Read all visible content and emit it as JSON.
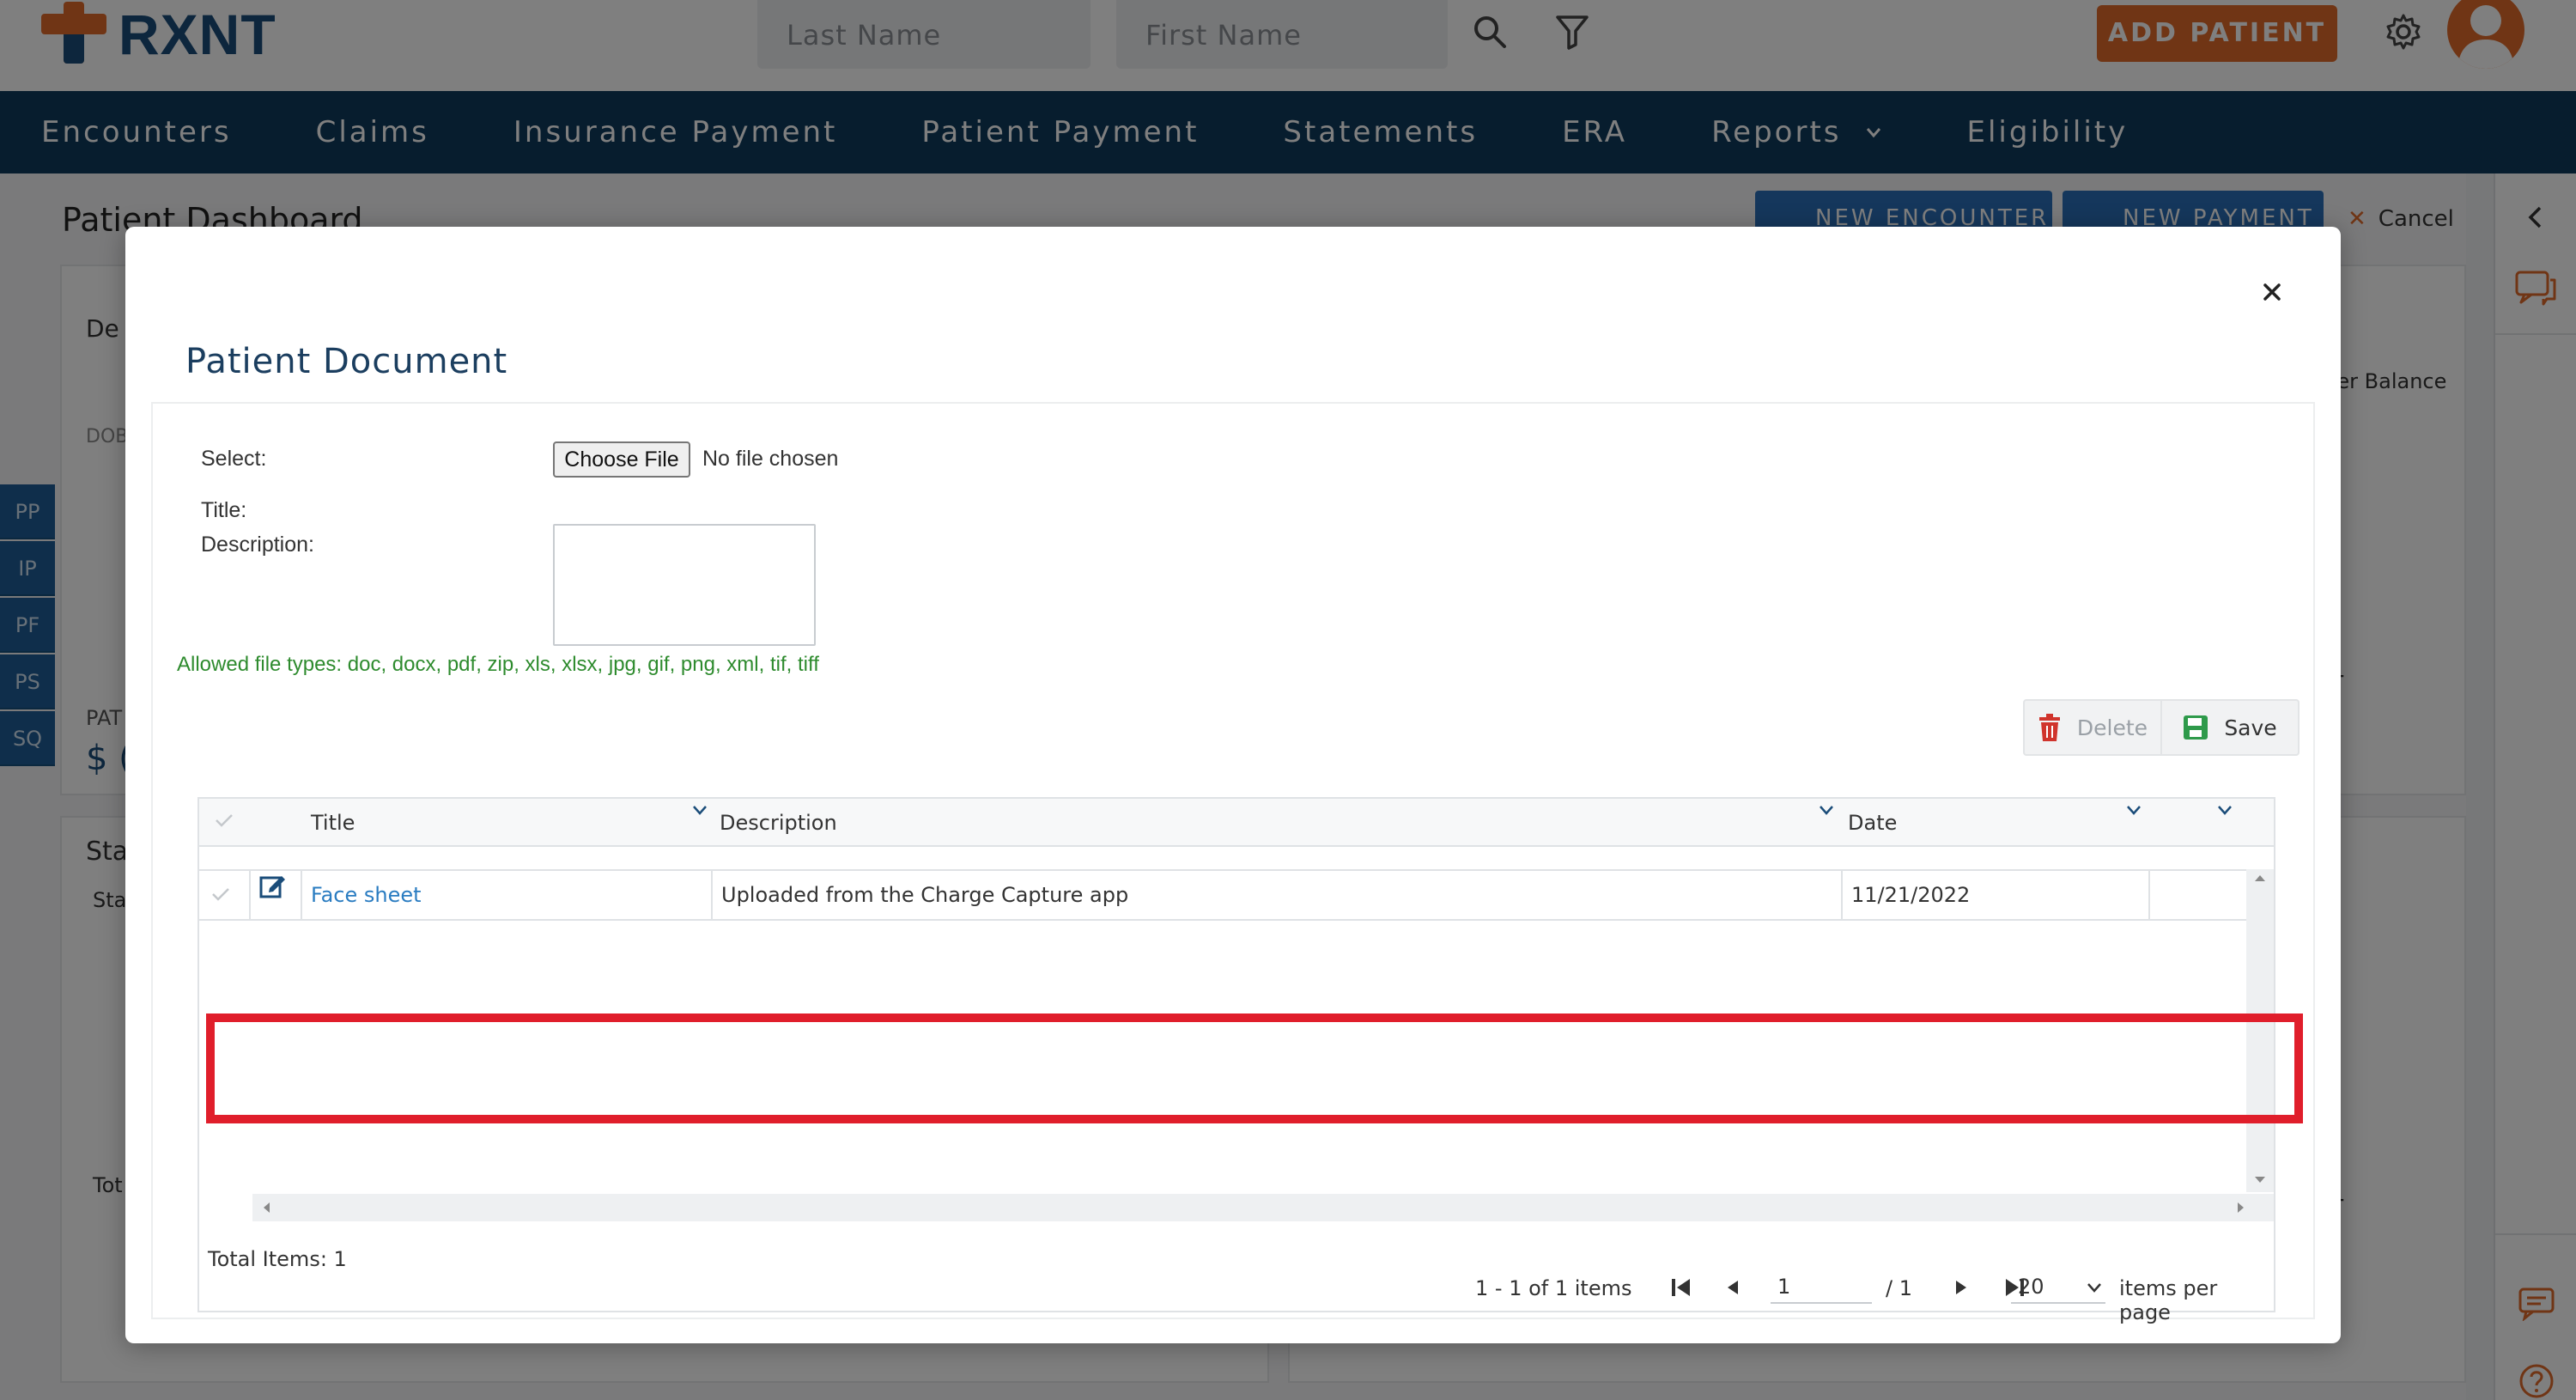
{
  "header": {
    "logo_text": "RXNT",
    "last_name_placeholder": "Last Name",
    "first_name_placeholder": "First Name",
    "add_patient_label": "ADD PATIENT"
  },
  "nav": {
    "items": [
      "Encounters",
      "Claims",
      "Insurance Payment",
      "Patient Payment",
      "Statements",
      "ERA",
      "Reports",
      "Eligibility"
    ]
  },
  "background": {
    "page_title": "Patient Dashboard",
    "new_encounter_label": "NEW ENCOUNTER",
    "new_payment_label": "NEW PAYMENT",
    "cancel_label": "Cancel",
    "card_label_1": "De",
    "card_label_dob": "DOB",
    "card_label_pat": "PAT",
    "card_label_balance_sign": "$ (",
    "card_label_sta": "Sta",
    "card_label_sta2": "Sta",
    "card_label_tot": "Tot",
    "column_hint": "ter Balance",
    "side_tabs": [
      "PP",
      "IP",
      "PF",
      "PS",
      "SQ"
    ],
    "pager_page": "1"
  },
  "modal": {
    "title": "Patient Document",
    "select_label": "Select:",
    "choose_file_label": "Choose File",
    "no_file_text": "No file chosen",
    "title_label": "Title:",
    "description_label": "Description:",
    "allowed_types": "Allowed file types: doc, docx, pdf, zip, xls, xlsx, jpg, gif, png, xml, tif, tiff",
    "delete_label": "Delete",
    "save_label": "Save",
    "grid": {
      "columns": [
        "Title",
        "Description",
        "Date"
      ],
      "rows": [
        {
          "title": "Face sheet",
          "description": "Uploaded from the Charge Capture app",
          "date": "11/21/2022"
        }
      ],
      "total_items": "Total Items: 1",
      "range_text": "1 - 1 of 1 items",
      "current_page": "1",
      "page_count": "/ 1",
      "page_size": "20",
      "per_page_label": "items per page"
    }
  },
  "colors": {
    "brand_navy": "#0f3a5c",
    "brand_orange": "#e06a2a",
    "link_blue": "#2a7cc1",
    "highlight_red": "#e01e2b",
    "allowed_green": "#2e8b2e"
  }
}
